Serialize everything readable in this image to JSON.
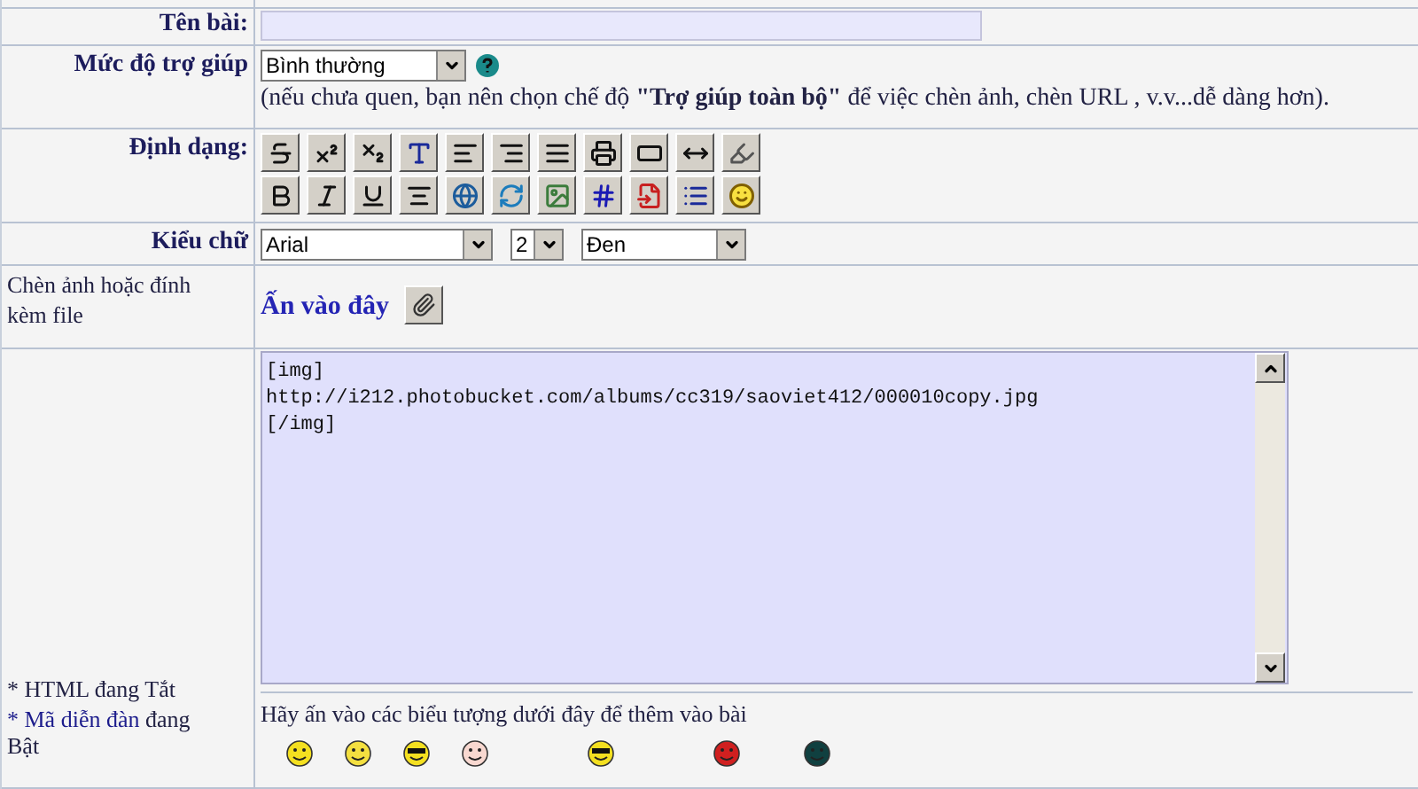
{
  "title_row": {
    "label": "Tên bài:"
  },
  "help_row": {
    "label": "Mức độ trợ giúp",
    "select": "Bình thường",
    "hint": "(nếu chưa quen, bạn nên chọn chế độ **\"Trợ giúp toàn bộ\"** để việc chèn ảnh, chèn URL , v.v...dễ dàng hơn)."
  },
  "format_row": {
    "label": "Định dạng:"
  },
  "font_row": {
    "label": "Kiểu chữ",
    "selects": [
      "Arial",
      "2",
      "Đen"
    ]
  },
  "attach_row": {
    "label": "Chèn ảnh hoặc đính kèm file",
    "link": "Ấn vào đây"
  },
  "message": {
    "value": "[img]\nhttp://i212.photobucket.com/albums/cc319/saoviet412/000010copy.jpg\n[/img]"
  },
  "status": {
    "html": "* HTML đang Tắt",
    "forum_code_prefix": "*",
    "forum_code_link": "Mã diễn đàn",
    "forum_code_suffix": "đang Bật"
  },
  "smilies": {
    "instruction": "Hãy ấn vào các biểu tượng dưới đây để thêm vào bài"
  }
}
